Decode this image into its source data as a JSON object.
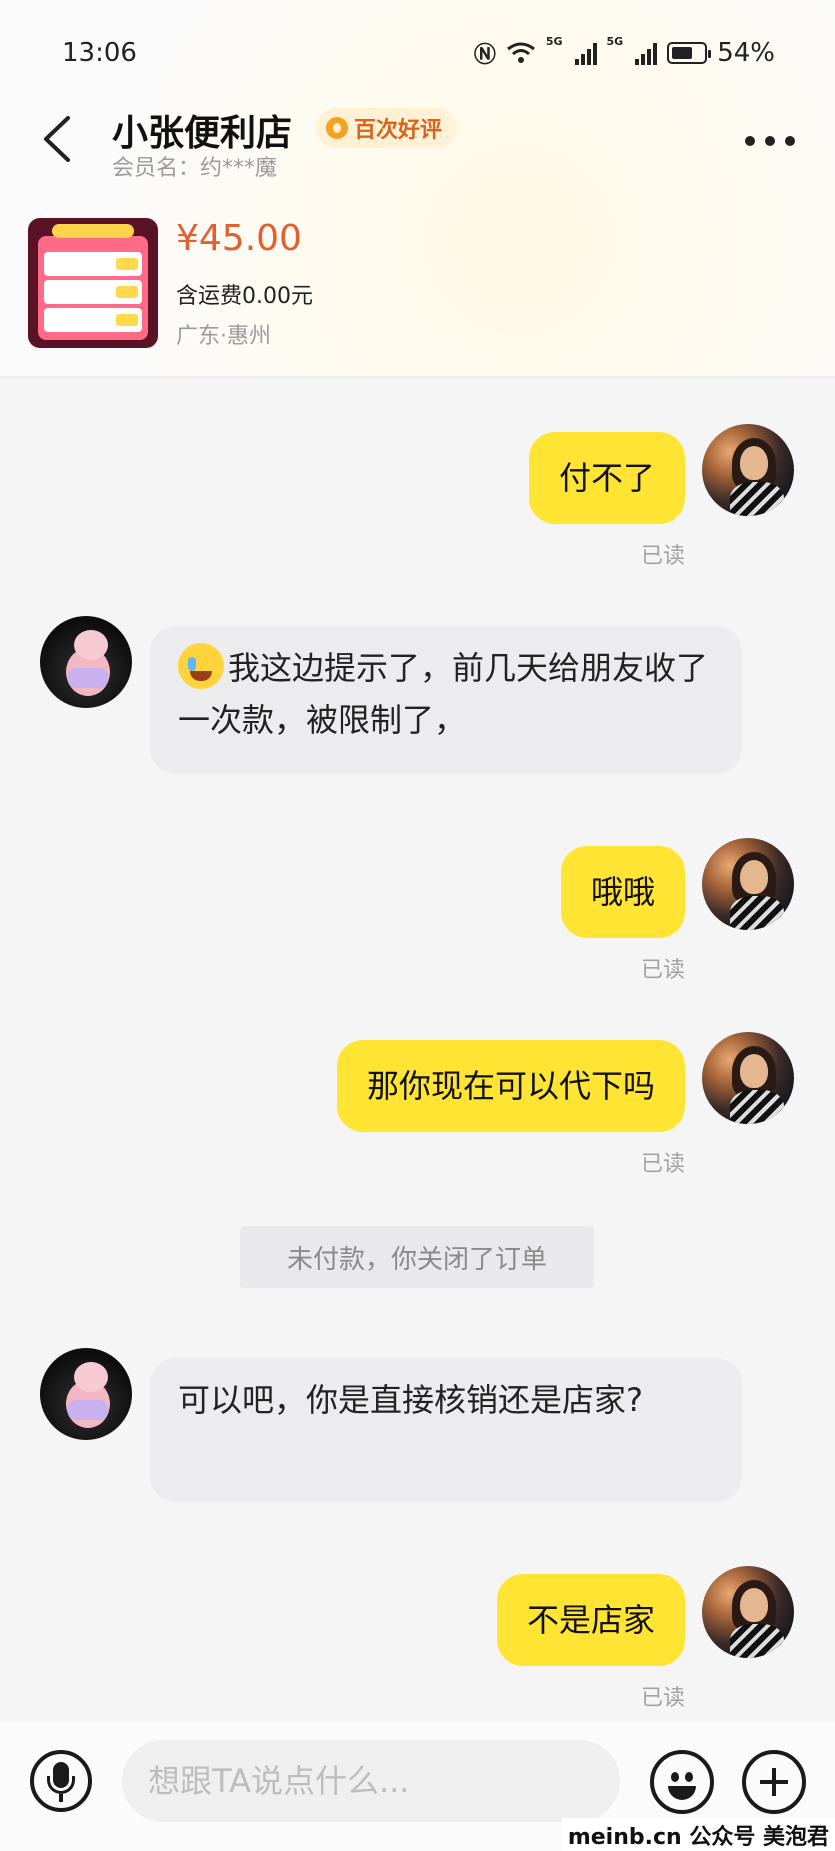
{
  "status_bar": {
    "time": "13:06",
    "net1": "5G",
    "net2": "5G",
    "battery_percent": "54%",
    "battery_level": 0.54
  },
  "header": {
    "shop_name": "小张便利店",
    "badge": "百次好评",
    "member": "会员名：约***魔"
  },
  "product": {
    "price": "¥45.00",
    "shipping": "含运费0.00元",
    "location": "广东·惠州"
  },
  "messages": [
    {
      "side": "me",
      "text": "付不了",
      "status": "已读"
    },
    {
      "side": "them",
      "text": "我这边提示了，前几天给朋友收了一次款，被限制了，",
      "emoji": "crying-laughing-emoji"
    },
    {
      "side": "me",
      "text": "哦哦",
      "status": "已读"
    },
    {
      "side": "me",
      "text": "那你现在可以代下吗",
      "status": "已读"
    },
    {
      "side": "system",
      "text": "未付款，你关闭了订单"
    },
    {
      "side": "them",
      "text": "可以吧，你是直接核销还是店家?"
    },
    {
      "side": "me",
      "text": "不是店家",
      "status": "已读"
    }
  ],
  "input": {
    "placeholder": "想跟TA说点什么..."
  },
  "watermark": "meinb.cn 公众号 美泡君",
  "colors": {
    "accent": "#ffe433",
    "price": "#e2602e",
    "badge_text": "#d9641a"
  }
}
